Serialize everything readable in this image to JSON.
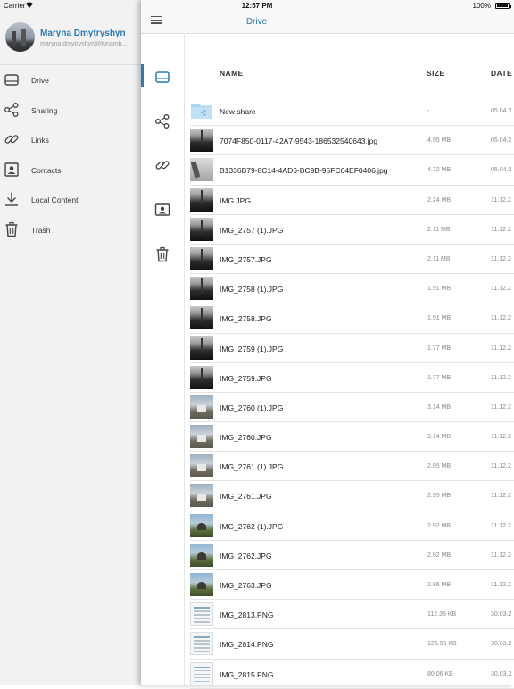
{
  "status_bar": {
    "carrier": "Carrier",
    "time": "12:57 PM",
    "battery": "100%"
  },
  "drawer": {
    "user_name": "Maryna Dmytryshyn",
    "user_email": "maryna.dmytryshyn@funamb...",
    "items": [
      {
        "label": "Drive",
        "icon": "drive-icon"
      },
      {
        "label": "Sharing",
        "icon": "share-icon"
      },
      {
        "label": "Links",
        "icon": "link-icon"
      },
      {
        "label": "Contacts",
        "icon": "contact-card-icon"
      },
      {
        "label": "Local Content",
        "icon": "download-icon"
      },
      {
        "label": "Trash",
        "icon": "trash-icon"
      }
    ]
  },
  "navbar": {
    "title": "Drive"
  },
  "columns": {
    "name": "NAME",
    "size": "SIZE",
    "date": "DATE"
  },
  "accent_color": "#2a7ab5",
  "files": [
    {
      "name": "New share",
      "size": "-",
      "date": "05.04.2",
      "kind": "folder"
    },
    {
      "name": "7074F850-0117-42A7-9543-186532540643.jpg",
      "size": "4.95 MB",
      "date": "05.04.2",
      "kind": "photo-dark"
    },
    {
      "name": "B1336B79-8C14-4AD6-BC9B-95FC64EF0406.jpg",
      "size": "4.72 MB",
      "date": "05.04.2",
      "kind": "photo-bed"
    },
    {
      "name": "IMG.JPG",
      "size": "2.24 MB",
      "date": "11.12.2",
      "kind": "photo-dark"
    },
    {
      "name": "IMG_2757 (1).JPG",
      "size": "2.11 MB",
      "date": "11.12.2",
      "kind": "photo-dark"
    },
    {
      "name": "IMG_2757.JPG",
      "size": "2.11 MB",
      "date": "11.12.2",
      "kind": "photo-dark"
    },
    {
      "name": "IMG_2758 (1).JPG",
      "size": "1.91 MB",
      "date": "11.12.2",
      "kind": "photo-dark"
    },
    {
      "name": "IMG_2758.JPG",
      "size": "1.91 MB",
      "date": "11.12.2",
      "kind": "photo-dark"
    },
    {
      "name": "IMG_2759 (1).JPG",
      "size": "1.77 MB",
      "date": "11.12.2",
      "kind": "photo-dark"
    },
    {
      "name": "IMG_2759.JPG",
      "size": "1.77 MB",
      "date": "11.12.2",
      "kind": "photo-dark"
    },
    {
      "name": "IMG_2760 (1).JPG",
      "size": "3.14 MB",
      "date": "11.12.2",
      "kind": "photo-day"
    },
    {
      "name": "IMG_2760.JPG",
      "size": "3.14 MB",
      "date": "11.12.2",
      "kind": "photo-day"
    },
    {
      "name": "IMG_2761 (1).JPG",
      "size": "2.95 MB",
      "date": "11.12.2",
      "kind": "photo-day"
    },
    {
      "name": "IMG_2761.JPG",
      "size": "2.95 MB",
      "date": "11.12.2",
      "kind": "photo-day"
    },
    {
      "name": "IMG_2762 (1).JPG",
      "size": "2.92 MB",
      "date": "11.12.2",
      "kind": "photo-tree"
    },
    {
      "name": "IMG_2762.JPG",
      "size": "2.92 MB",
      "date": "11.12.2",
      "kind": "photo-tree"
    },
    {
      "name": "IMG_2763.JPG",
      "size": "2.86 MB",
      "date": "11.12.2",
      "kind": "photo-tree"
    },
    {
      "name": "IMG_2813.PNG",
      "size": "112.35 KB",
      "date": "30.03.2",
      "kind": "shot"
    },
    {
      "name": "IMG_2814.PNG",
      "size": "126.95 KB",
      "date": "30.03.2",
      "kind": "shot"
    },
    {
      "name": "IMG_2815.PNG",
      "size": "80.06 KB",
      "date": "30.03.2",
      "kind": "shot"
    }
  ]
}
